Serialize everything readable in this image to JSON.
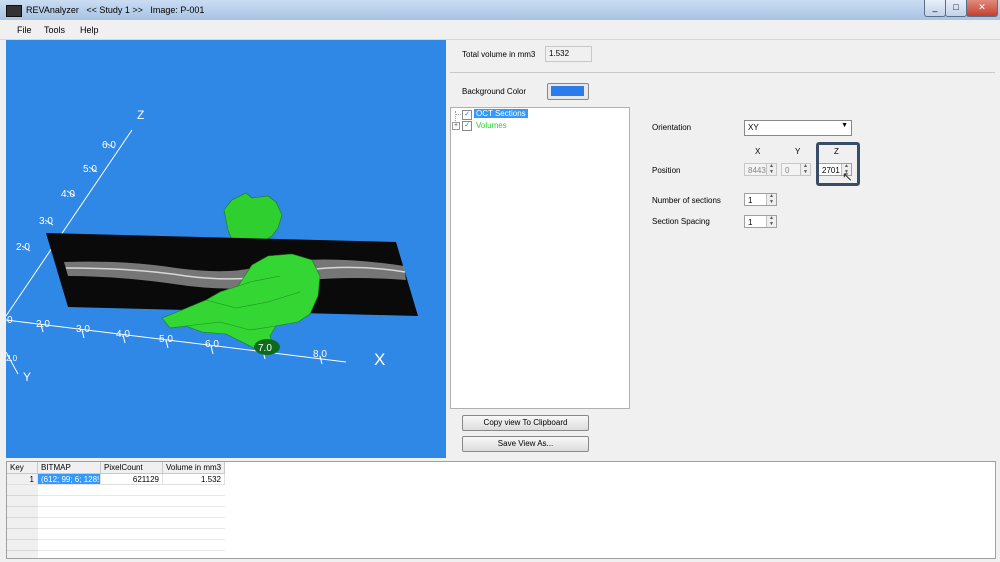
{
  "window": {
    "title": "REVAnalyzer   << Study 1 >>   Image: P-001",
    "controls": [
      "_",
      "□",
      "✕"
    ]
  },
  "menu": [
    "File",
    "Tools",
    "Help"
  ],
  "viewport": {
    "background": "#2f87e6",
    "axis_labels": {
      "z": "Z",
      "x": "X",
      "y": "Y"
    },
    "z_ticks": [
      "6.0",
      "5.0",
      "4.0",
      "3.0",
      "2.0"
    ],
    "x_ticks": [
      "0",
      "2.0",
      "3.0",
      "4.0",
      "5.0",
      "6.0",
      "7.0",
      "8.0"
    ],
    "y_tick": "2.0"
  },
  "panel": {
    "total_volume_label": "Total volume in mm3",
    "total_volume_value": "1.532",
    "background_color_label": "Background Color",
    "background_color_swatch": "#2b7bea",
    "tree": [
      {
        "label": "OCT Sections",
        "checked": true
      },
      {
        "label": "Volumes",
        "checked": true
      }
    ],
    "orientation_label": "Orientation",
    "orientation_value": "XY",
    "col_x": "X",
    "col_y": "Y",
    "col_z": "Z",
    "position_label": "Position",
    "position_x": "8443",
    "position_y": "0",
    "position_z": "2701",
    "num_sections_label": "Number of sections",
    "num_sections_value": "1",
    "section_spacing_label": "Section Spacing",
    "section_spacing_value": "1",
    "copy_button": "Copy view To Clipboard",
    "save_button": "Save View As..."
  },
  "table": {
    "headers": [
      "Key",
      "BITMAP",
      "PixelCount",
      "Volume in mm3"
    ],
    "rows": [
      {
        "key": "1",
        "bitmap": "(612; 99; 6; 128!",
        "pixels": "621129",
        "volume": "1.532"
      }
    ]
  }
}
